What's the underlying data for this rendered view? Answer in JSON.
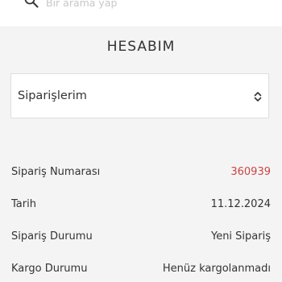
{
  "search": {
    "placeholder": "Bir arama yap"
  },
  "page": {
    "title": "HESABIM"
  },
  "section_select": {
    "selected": "Siparişlerim"
  },
  "order_details": [
    {
      "label": "Sipariş Numarası",
      "value": "360939"
    },
    {
      "label": "Tarih",
      "value": "11.12.2024"
    },
    {
      "label": "Sipariş Durumu",
      "value": "Yeni Sipariş"
    },
    {
      "label": "Kargo Durumu",
      "value": "Henüz kargolanmadı"
    }
  ],
  "colors": {
    "order_number": "#cc4444",
    "background": "#f4f4f4"
  },
  "icons": {
    "search": "search-icon",
    "select_arrow": "chevron-up-down-icon"
  }
}
